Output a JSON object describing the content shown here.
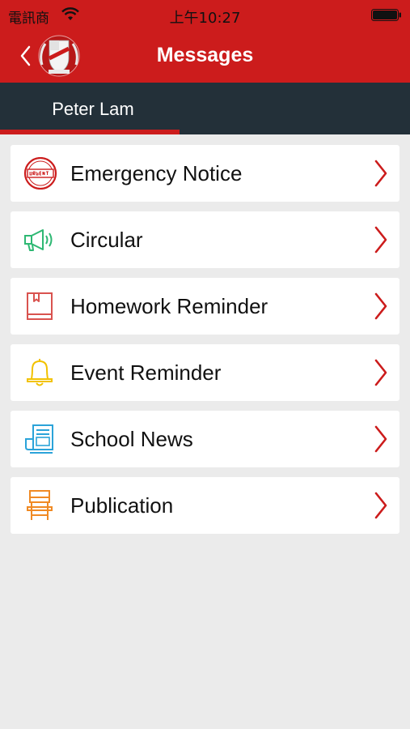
{
  "status_bar": {
    "carrier": "電訊商",
    "time": "上午10:27",
    "icons": [
      "wifi-icon",
      "battery-icon"
    ]
  },
  "nav": {
    "title": "Messages",
    "back_icon": "chevron-left-icon",
    "logo": "school-crest-logo"
  },
  "tabs": [
    {
      "label": "Peter Lam",
      "selected": true
    }
  ],
  "colors": {
    "brand_red": "#cc1c1c",
    "tab_bg": "#233039",
    "list_bg": "#ebebeb",
    "emergency": "#cc1c1c",
    "circular": "#2eb873",
    "homework": "#d9534f",
    "event": "#f2c200",
    "news": "#2ba3d9",
    "publication": "#f08a24"
  },
  "menu": [
    {
      "label": "Emergency Notice",
      "icon": "urgent-stamp-icon"
    },
    {
      "label": "Circular",
      "icon": "megaphone-icon"
    },
    {
      "label": "Homework Reminder",
      "icon": "book-icon"
    },
    {
      "label": "Event Reminder",
      "icon": "bell-icon"
    },
    {
      "label": "School News",
      "icon": "newspaper-icon"
    },
    {
      "label": "Publication",
      "icon": "lectern-icon"
    }
  ]
}
